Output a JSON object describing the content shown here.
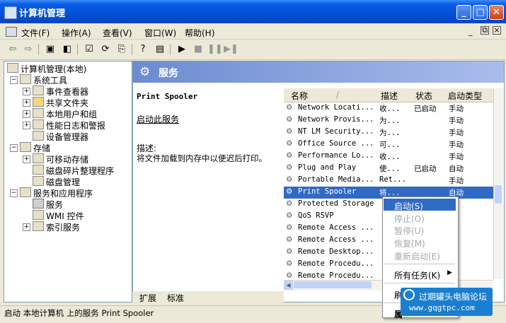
{
  "window": {
    "title": "计算机管理"
  },
  "menu": [
    "文件(F)",
    "操作(A)",
    "查看(V)",
    "窗口(W)",
    "帮助(H)"
  ],
  "tree": {
    "root": "计算机管理(本地)",
    "system_tools": "系统工具",
    "event_viewer": "事件查看器",
    "shared_folders": "共享文件夹",
    "local_users": "本地用户和组",
    "perf_logs": "性能日志和警报",
    "device_manager": "设备管理器",
    "storage": "存储",
    "removable": "可移动存储",
    "defrag": "磁盘碎片整理程序",
    "disk_mgmt": "磁盘管理",
    "services_apps": "服务和应用程序",
    "services": "服务",
    "wmi": "WMI 控件",
    "indexing": "索引服务"
  },
  "pane": {
    "header": "服务",
    "service_name": "Print Spooler",
    "start_link": "启动此服务",
    "desc_label": "描述:",
    "desc_text": "将文件加载到内存中以便迟后打印。"
  },
  "list": {
    "columns": {
      "name": "名称",
      "desc": "描述",
      "status": "状态",
      "startup": "启动类型"
    },
    "rows": [
      {
        "name": "Network Locati...",
        "desc": "收...",
        "status": "已启动",
        "startup": "手动"
      },
      {
        "name": "Network Provis...",
        "desc": "为...",
        "status": "",
        "startup": "手动"
      },
      {
        "name": "NT LM Security...",
        "desc": "为...",
        "status": "",
        "startup": "手动"
      },
      {
        "name": "Office Source ...",
        "desc": "可...",
        "status": "",
        "startup": "手动"
      },
      {
        "name": "Performance Lo...",
        "desc": "收...",
        "status": "",
        "startup": "手动"
      },
      {
        "name": "Plug and Play",
        "desc": "使...",
        "status": "已启动",
        "startup": "自动"
      },
      {
        "name": "Portable Media...",
        "desc": "Ret...",
        "status": "",
        "startup": "手动"
      },
      {
        "name": "Print Spooler",
        "desc": "将...",
        "status": "",
        "startup": "自动"
      },
      {
        "name": "Protected Storage",
        "desc": "",
        "status": "",
        "startup": ""
      },
      {
        "name": "QoS RSVP",
        "desc": "",
        "status": "",
        "startup": ""
      },
      {
        "name": "Remote Access ...",
        "desc": "",
        "status": "",
        "startup": ""
      },
      {
        "name": "Remote Access ...",
        "desc": "",
        "status": "",
        "startup": ""
      },
      {
        "name": "Remote Desktop...",
        "desc": "",
        "status": "",
        "startup": ""
      },
      {
        "name": "Remote Procedu...",
        "desc": "",
        "status": "",
        "startup": ""
      },
      {
        "name": "Remote Procedu...",
        "desc": "",
        "status": "",
        "startup": ""
      }
    ]
  },
  "context_menu": {
    "start": "启动(S)",
    "stop": "停止(O)",
    "pause": "暂停(U)",
    "resume": "恢复(M)",
    "restart": "重新启动(E)",
    "all_tasks": "所有任务(K)",
    "refresh": "刷",
    "properties": "属"
  },
  "tabs": {
    "extended": "扩展",
    "standard": "标准"
  },
  "status": "启动 本地计算机 上的服务 Print Spooler",
  "watermark": {
    "line1": "过期罐头电脑论坛",
    "line2": "www.gqgtpc.com"
  },
  "colors": {
    "titlebar": "#0450D6",
    "selection": "#316AC5",
    "header_band": "#6C8BD1"
  },
  "icons": [
    "back-icon",
    "forward-icon",
    "up-folder-icon",
    "console-tree-icon",
    "properties-icon",
    "refresh-icon",
    "export-icon",
    "help-icon",
    "view-icon",
    "play-icon",
    "stop-icon",
    "pause-icon",
    "restart-icon",
    "gear-icon"
  ]
}
